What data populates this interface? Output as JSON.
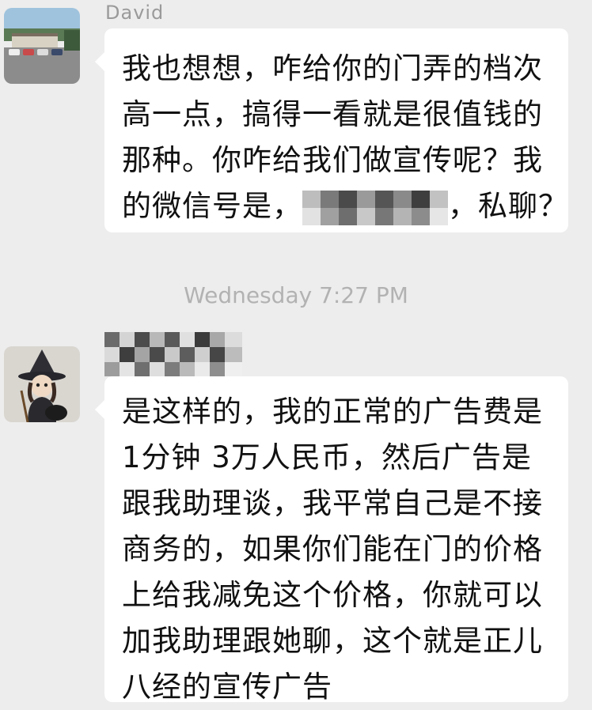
{
  "messages": [
    {
      "sender": "David",
      "lines": [
        "我也想想，咋给你的门弄的档次",
        "高一点，搞得一看就是很值钱的",
        "那种。你咋给我们做宣传呢？我",
        "的微信号是，",
        "，私聊？"
      ]
    },
    {
      "lines": [
        "是这样的，我的正常的广告费是",
        "1分钟 3万人民币，然后广告是",
        "跟我助理谈，我平常自己是不接",
        "商务的，如果你们能在门的价格",
        "上给我减免这个价格，你就可以",
        "加我助理跟她聊，这个就是正儿",
        "八经的宣传广告"
      ]
    }
  ],
  "timestamp": "Wednesday 7:27 PM"
}
